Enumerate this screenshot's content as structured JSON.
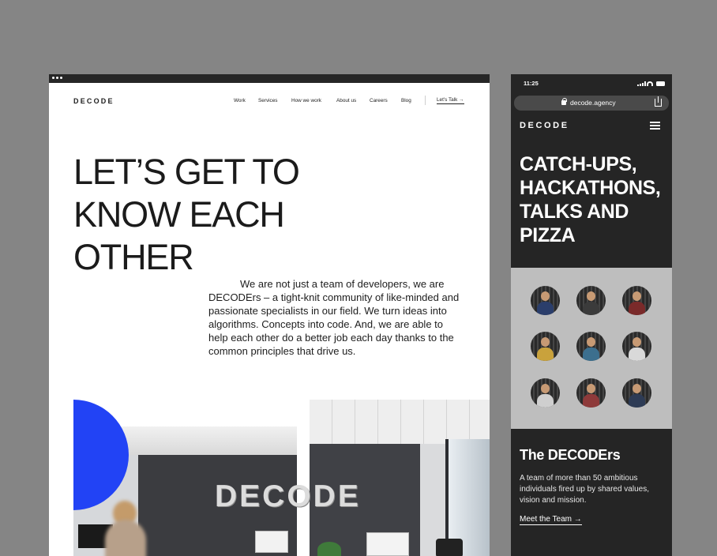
{
  "desktop": {
    "logo": "DECODE",
    "nav": [
      "Work",
      "Services",
      "How we work",
      "About us",
      "Careers",
      "Blog"
    ],
    "cta": "Let's Talk →",
    "headline": "LET’S GET TO KNOW EACH OTHER",
    "body": "We are not just a team of developers, we are DECODErs – a tight-knit community of like-minded and passionate specialists in our field. We turn ideas into algorithms. Concepts into code. And, we are able to help each other do a better job each day thanks to the common principles that drive us.",
    "wall_sign": "DECODE",
    "accent_color": "#2243f5"
  },
  "mobile": {
    "time": "11:25",
    "url": "decode.agency",
    "logo": "DECODE",
    "headline": "CATCH-UPS, HACKATHONS, TALKS AND PIZZA",
    "section_title": "The DECODErs",
    "section_body": "A team of more than 50 ambitious individuals fired up by shared values, vision and mission.",
    "link": "Meet the Team →",
    "team_photo_count": 9
  },
  "icons": [
    "lock-icon",
    "share-icon",
    "hamburger-menu-icon",
    "signal-icon",
    "wifi-icon",
    "battery-icon"
  ]
}
